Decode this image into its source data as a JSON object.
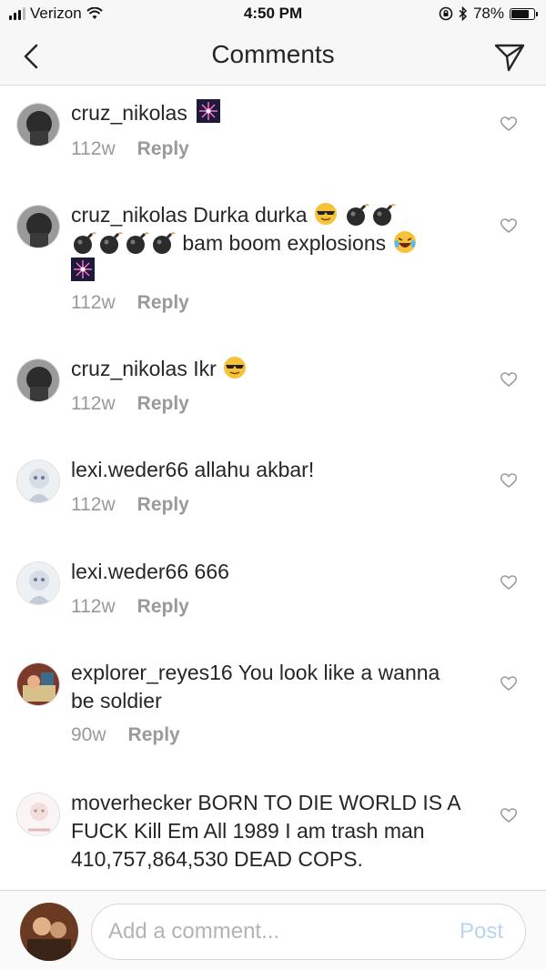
{
  "status_bar": {
    "carrier": "Verizon",
    "time": "4:50 PM",
    "battery": "78%",
    "battery_level": 0.78
  },
  "nav": {
    "title": "Comments"
  },
  "comments": [
    {
      "username": "cruz_nikolas",
      "text": "",
      "age": "112w",
      "reply_label": "Reply"
    },
    {
      "username": "cruz_nikolas",
      "text_1": "Durka durka",
      "text_2": "bam boom explosions",
      "age": "112w",
      "reply_label": "Reply"
    },
    {
      "username": "cruz_nikolas",
      "text": "Ikr",
      "age": "112w",
      "reply_label": "Reply"
    },
    {
      "username": "lexi.weder66",
      "text": "allahu akbar!",
      "age": "112w",
      "reply_label": "Reply"
    },
    {
      "username": "lexi.weder66",
      "text": "666",
      "age": "112w",
      "reply_label": "Reply"
    },
    {
      "username": "explorer_reyes16",
      "text": "You look like a wanna be soldier",
      "age": "90w",
      "reply_label": "Reply"
    },
    {
      "username": "moverhecker",
      "text": "BORN TO DIE WORLD IS A FUCK Kill Em All 1989 I am trash man 410,757,864,530 DEAD COPS.",
      "age": "",
      "reply_label": ""
    }
  ],
  "composer": {
    "placeholder": "Add a comment...",
    "post_label": "Post"
  },
  "colors": {
    "text": "#262626",
    "meta": "#999999",
    "post_disabled": "#b7d4f2",
    "bar_bg": "#f7f7f7"
  }
}
